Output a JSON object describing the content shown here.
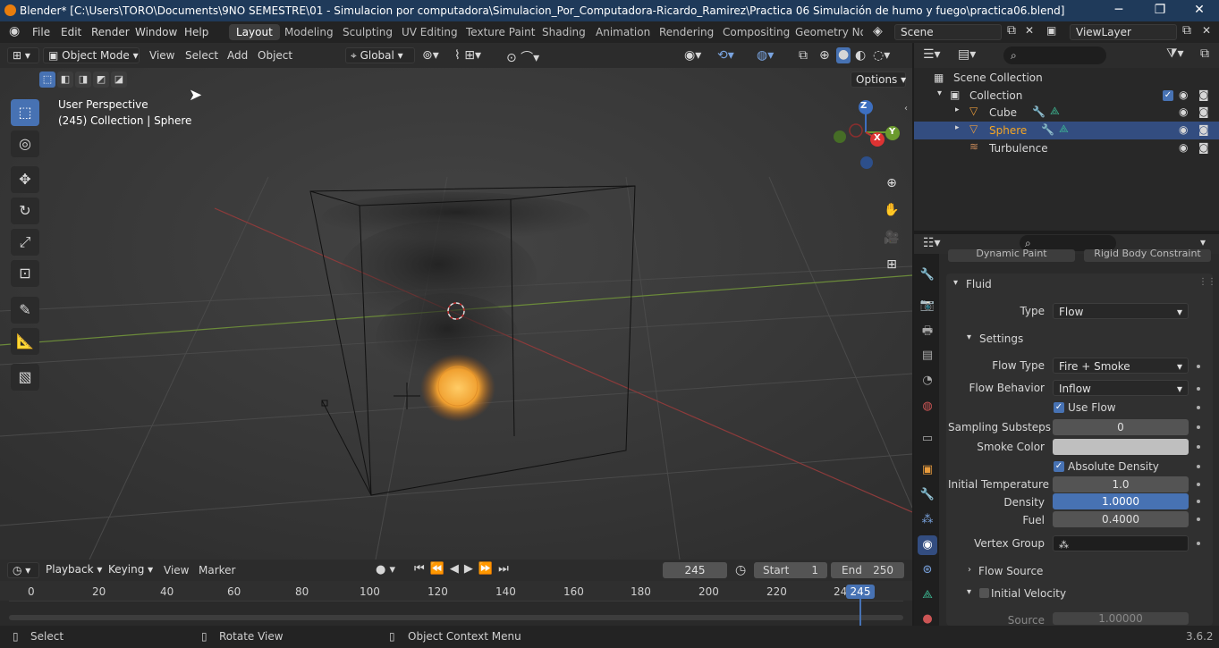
{
  "window": {
    "title": "Blender* [C:\\Users\\TORO\\Documents\\9NO SEMESTRE\\01 - Simulacion por computadora\\Simulacion_Por_Computadora-Ricardo_Ramirez\\Practica 06 Simulación de humo y fuego\\practica06.blend]"
  },
  "menu": [
    "File",
    "Edit",
    "Render",
    "Window",
    "Help"
  ],
  "workspaces": [
    "Layout",
    "Modeling",
    "Sculpting",
    "UV Editing",
    "Texture Paint",
    "Shading",
    "Animation",
    "Rendering",
    "Compositing",
    "Geometry Noc"
  ],
  "active_workspace": "Layout",
  "scene": "Scene",
  "view_layer": "ViewLayer",
  "viewport_header": {
    "mode": "Object Mode",
    "view": "View",
    "select": "Select",
    "add": "Add",
    "object": "Object",
    "orientation": "Global",
    "options": "Options"
  },
  "viewport": {
    "perspective": "User Perspective",
    "context": "(245) Collection | Sphere"
  },
  "gizmo": {
    "z": "Z",
    "y": "Y",
    "x": "X"
  },
  "outliner": {
    "root": "Scene Collection",
    "collection": "Collection",
    "items": [
      {
        "name": "Cube"
      },
      {
        "name": "Sphere"
      },
      {
        "name": "Turbulence"
      }
    ]
  },
  "properties": {
    "tabs_top": [
      "Dynamic Paint",
      "Rigid Body Constraint"
    ],
    "panel": "Fluid",
    "type_label": "Type",
    "type_value": "Flow",
    "settings": "Settings",
    "rows": [
      {
        "label": "Flow Type",
        "value": "Fire + Smoke"
      },
      {
        "label": "Flow Behavior",
        "value": "Inflow"
      }
    ],
    "use_flow": "Use Flow",
    "sampling_label": "Sampling Substeps",
    "sampling_value": "0",
    "smoke_color_label": "Smoke Color",
    "absolute_density": "Absolute Density",
    "init_temp_label": "Initial Temperature",
    "init_temp_value": "1.0",
    "density_label": "Density",
    "density_value": "1.0000",
    "fuel_label": "Fuel",
    "fuel_value": "0.4000",
    "vertex_group_label": "Vertex Group",
    "flow_source": "Flow Source",
    "initial_velocity": "Initial Velocity",
    "source_label": "Source",
    "source_value": "1.00000"
  },
  "timeline": {
    "playback": "Playback",
    "keying": "Keying",
    "view": "View",
    "marker": "Marker",
    "current_frame": "245",
    "start_label": "Start",
    "start": "1",
    "end_label": "End",
    "end": "250",
    "ticks": [
      "0",
      "20",
      "40",
      "60",
      "80",
      "100",
      "120",
      "140",
      "160",
      "180",
      "200",
      "220",
      "24"
    ],
    "playhead": "245"
  },
  "status": {
    "select": "Select",
    "rotate": "Rotate View",
    "context_menu": "Object Context Menu",
    "version": "3.6.2"
  }
}
